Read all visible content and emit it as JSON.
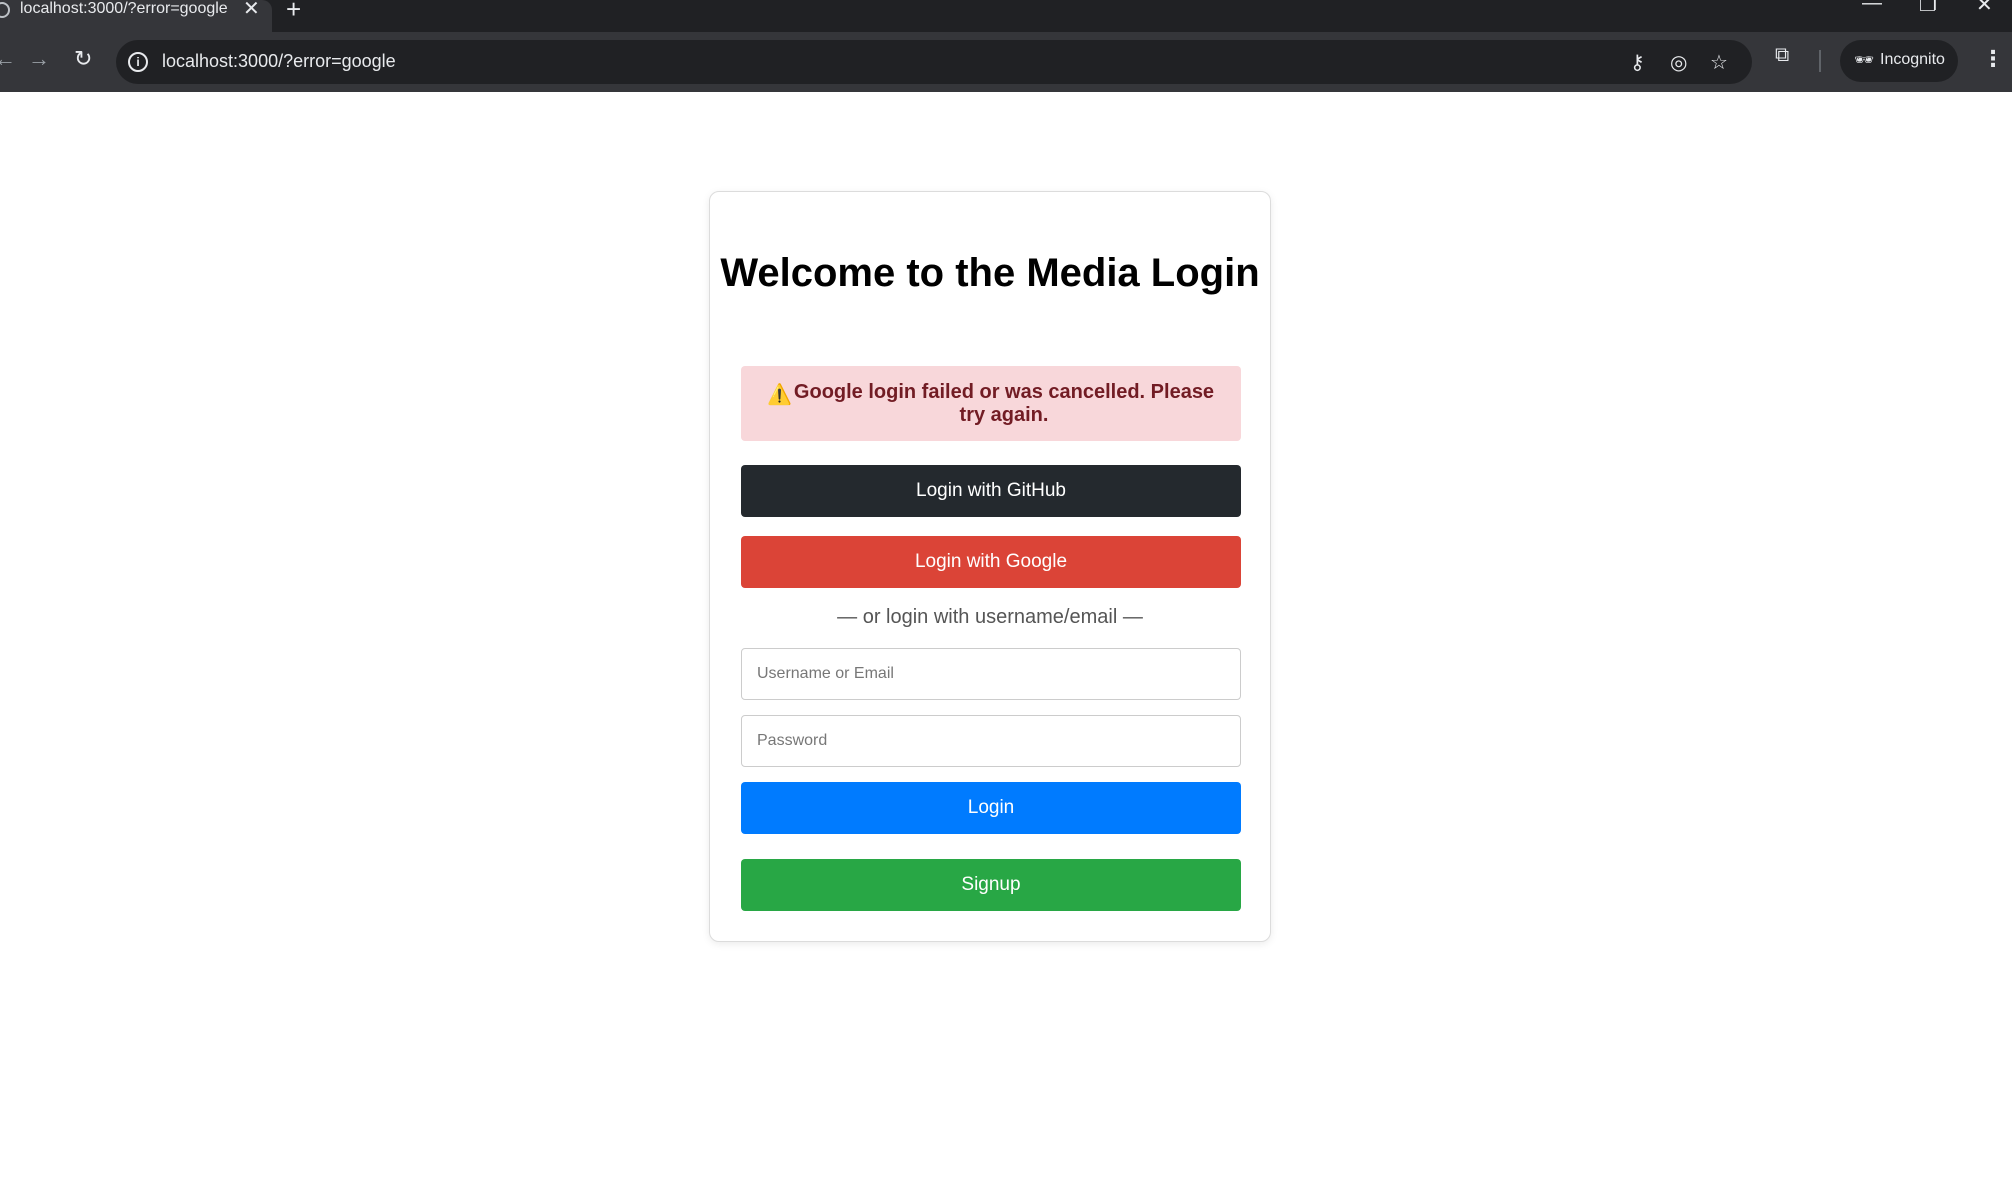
{
  "browser": {
    "tab_title": "localhost:3000/?error=google",
    "tab_close": "✕",
    "new_tab": "+",
    "window_controls": {
      "minimize": "—",
      "restore": "❐",
      "close": "✕"
    },
    "nav": {
      "back": "←",
      "forward": "→",
      "reload": "↻"
    },
    "address": "localhost:3000/?error=google",
    "info_icon": "i",
    "omnibox_icons": {
      "key": "⚷",
      "eye_off": "◎",
      "star": "☆"
    },
    "profile_icon": "⧉",
    "incognito_label": "Incognito",
    "incognito_icon": "🕶",
    "menu": "⋮"
  },
  "page": {
    "heading": "Welcome to the Media Login",
    "alert": {
      "icon": "⚠️",
      "message": "Google login failed or was cancelled. Please try again.",
      "bg_color": "#f8d7da",
      "text_color": "#721c24"
    },
    "github_button": "Login with GitHub",
    "google_button": "Login with Google",
    "divider_text": "— or login with username/email —",
    "username_placeholder": "Username or Email",
    "password_placeholder": "Password",
    "login_button": "Login",
    "signup_button": "Signup",
    "colors": {
      "github": "#24292e",
      "google": "#db4437",
      "login": "#007bff",
      "signup": "#28a745"
    }
  }
}
